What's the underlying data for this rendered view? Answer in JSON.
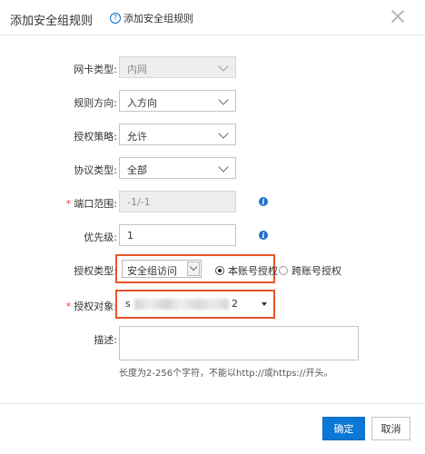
{
  "dialog": {
    "title": "添加安全组规则",
    "help_link": "添加安全组规则",
    "help_icon": "question-circle-icon",
    "close_icon": "close-icon"
  },
  "form": {
    "nic_type": {
      "label": "网卡类型:",
      "value": "内网"
    },
    "direction": {
      "label": "规则方向:",
      "value": "入方向"
    },
    "policy": {
      "label": "授权策略:",
      "value": "允许"
    },
    "protocol": {
      "label": "协议类型:",
      "value": "全部"
    },
    "port_range": {
      "label": "端口范围:",
      "value": "-1/-1",
      "required_mark": "*"
    },
    "priority": {
      "label": "优先级:",
      "value": "1"
    },
    "auth_type": {
      "label": "授权类型:",
      "value": "安全组访问",
      "options": [
        {
          "label": "本账号授权",
          "checked": true
        },
        {
          "label": "跨账号授权",
          "checked": false
        }
      ]
    },
    "auth_target": {
      "label": "授权对象:",
      "value_prefix": "s",
      "value_suffix": "2",
      "required_mark": "*"
    },
    "description": {
      "label": "描述:",
      "value": "",
      "hint": "长度为2-256个字符，不能以http://或https://开头。"
    }
  },
  "footer": {
    "confirm": "确定",
    "cancel": "取消"
  },
  "colors": {
    "primary": "#0b77d6",
    "highlight": "#e8552a",
    "required": "#e84545",
    "info": "#1e6fd1"
  }
}
